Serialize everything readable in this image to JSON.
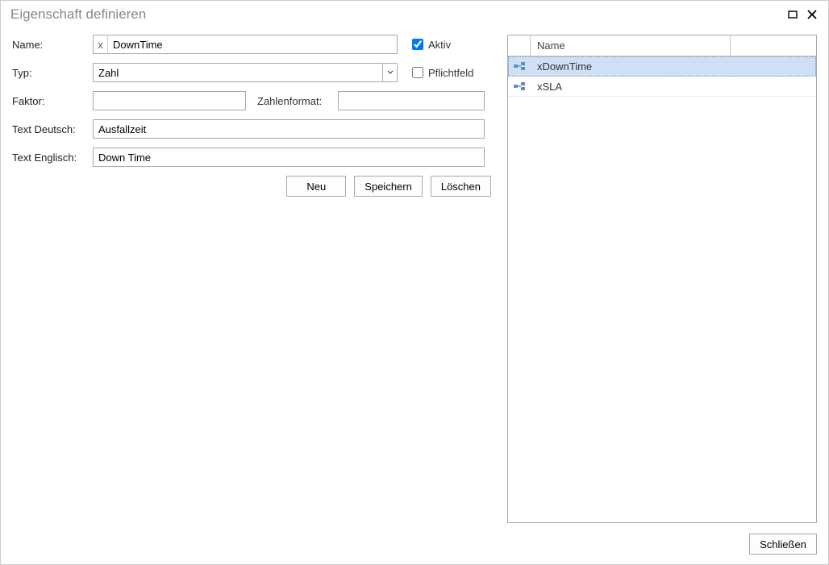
{
  "window": {
    "title": "Eigenschaft definieren"
  },
  "form": {
    "name_label": "Name:",
    "name_prefix": "x",
    "name_value": "DownTime",
    "active_label": "Aktiv",
    "active_checked": true,
    "type_label": "Typ:",
    "type_value": "Zahl",
    "mandatory_label": "Pflichtfeld",
    "mandatory_checked": false,
    "factor_label": "Faktor:",
    "factor_value": "",
    "numfmt_label": "Zahlenformat:",
    "numfmt_value": "",
    "text_de_label": "Text Deutsch:",
    "text_de_value": "Ausfallzeit",
    "text_en_label": "Text Englisch:",
    "text_en_value": "Down Time"
  },
  "buttons": {
    "new": "Neu",
    "save": "Speichern",
    "delete": "Löschen",
    "close": "Schließen"
  },
  "grid": {
    "header_name": "Name",
    "rows": [
      {
        "name": "xDownTime",
        "selected": true
      },
      {
        "name": "xSLA",
        "selected": false
      }
    ]
  }
}
